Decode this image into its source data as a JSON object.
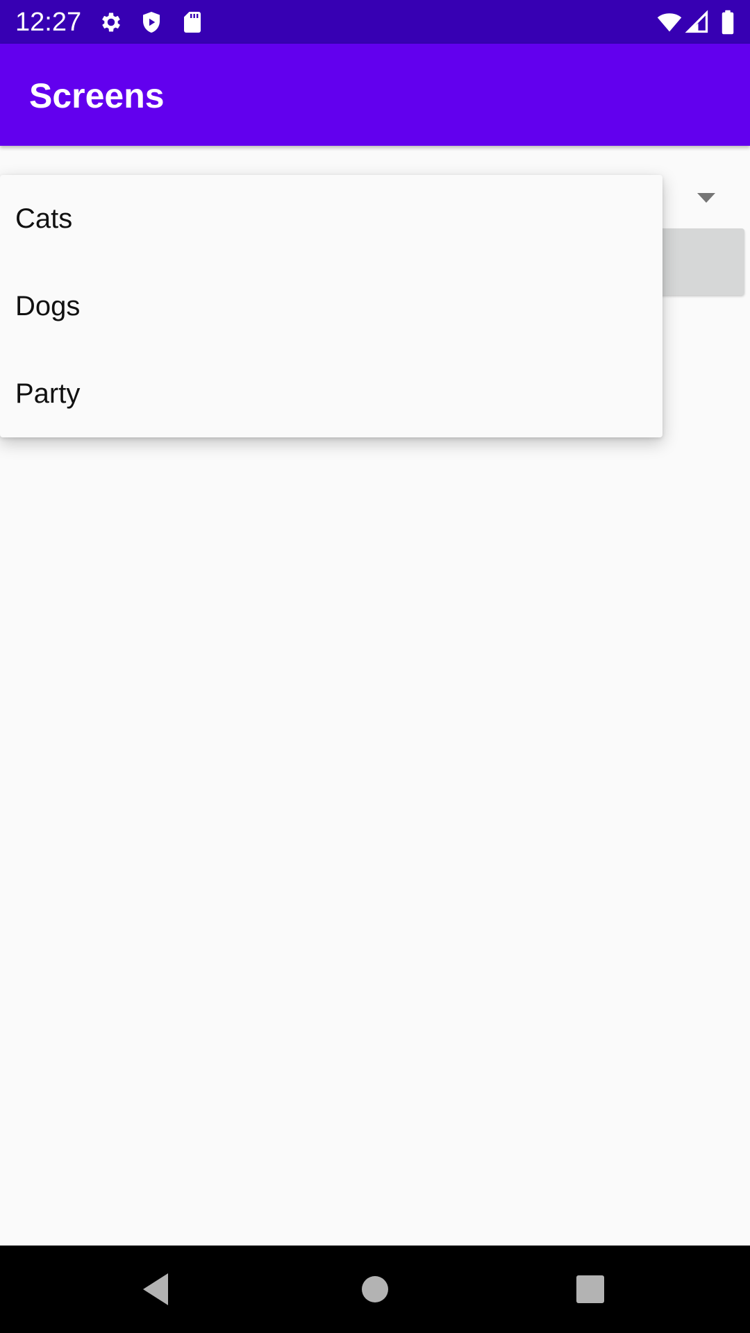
{
  "status_bar": {
    "time": "12:27",
    "left_icons": [
      "gear-icon",
      "shield-play-icon",
      "sd-card-icon"
    ],
    "right_icons": [
      "wifi-icon",
      "cell-signal-icon",
      "battery-icon"
    ]
  },
  "app_bar": {
    "title": "Screens",
    "color": "#6200ee"
  },
  "spinner": {
    "icon": "dropdown-arrow-icon",
    "options": [
      {
        "label": "Cats"
      },
      {
        "label": "Dogs"
      },
      {
        "label": "Party"
      }
    ]
  },
  "nav_bar": {
    "buttons": [
      "back-icon",
      "home-icon",
      "recents-icon"
    ]
  },
  "colors": {
    "status_bar": "#3700b3",
    "accent": "#6200ee",
    "background": "#fafafa",
    "button_gray": "#d6d7d7"
  }
}
